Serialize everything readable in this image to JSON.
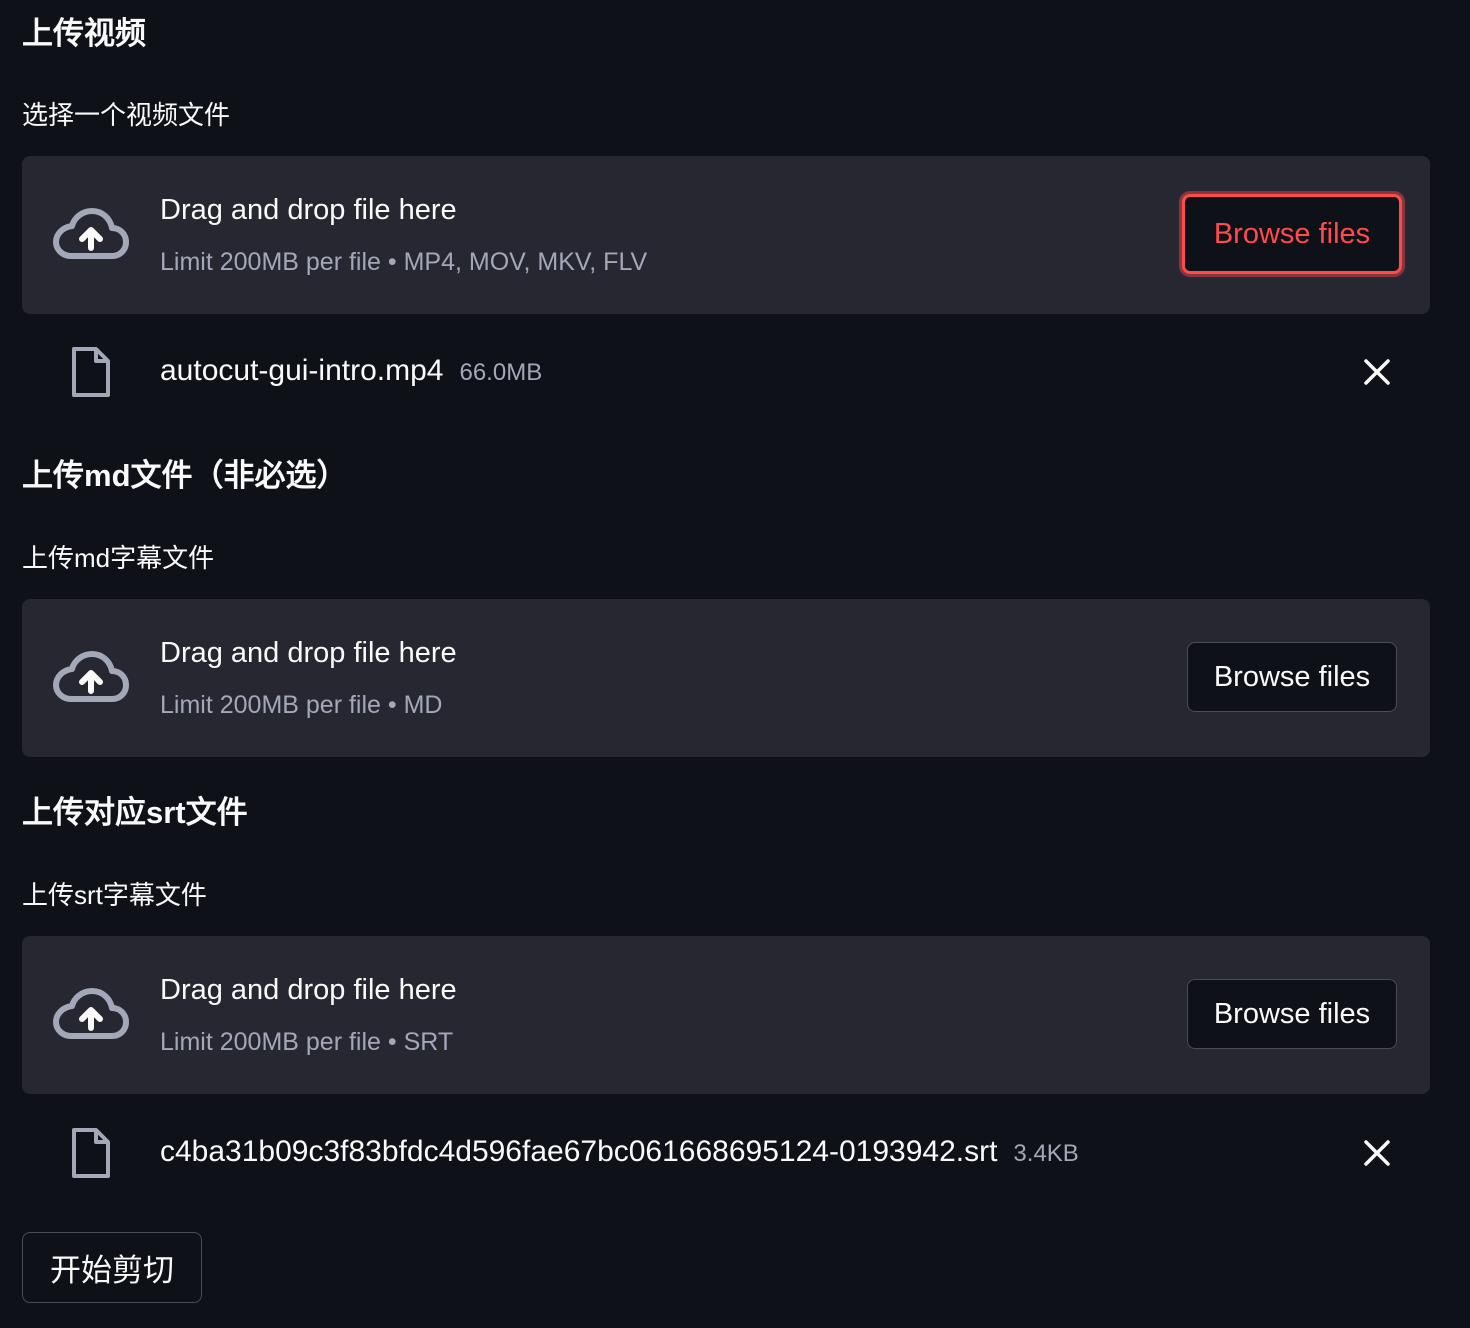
{
  "sections": [
    {
      "heading": "上传视频",
      "label": "选择一个视频文件",
      "dropzone": {
        "title": "Drag and drop file here",
        "subtitle": "Limit 200MB per file • MP4, MOV, MKV, FLV",
        "button": "Browse files",
        "button_focused": true
      },
      "file": {
        "name": "autocut-gui-intro.mp4",
        "size": "66.0MB"
      }
    },
    {
      "heading": "上传md文件（非必选）",
      "label": "上传md字幕文件",
      "dropzone": {
        "title": "Drag and drop file here",
        "subtitle": "Limit 200MB per file • MD",
        "button": "Browse files"
      }
    },
    {
      "heading": "上传对应srt文件",
      "label": "上传srt字幕文件",
      "dropzone": {
        "title": "Drag and drop file here",
        "subtitle": "Limit 200MB per file • SRT",
        "button": "Browse files"
      },
      "file": {
        "name": "c4ba31b09c3f83bfdc4d596fae67bc061668695124-0193942.srt",
        "size": "3.4KB"
      }
    }
  ],
  "action_button": "开始剪切",
  "icons": {
    "upload": "cloud-upload-icon",
    "file": "file-icon",
    "remove": "close-icon"
  },
  "colors": {
    "background": "#0e1117",
    "dropzone": "#262730",
    "accent": "#ff4b4b",
    "muted_text": "#a3a8b8"
  }
}
